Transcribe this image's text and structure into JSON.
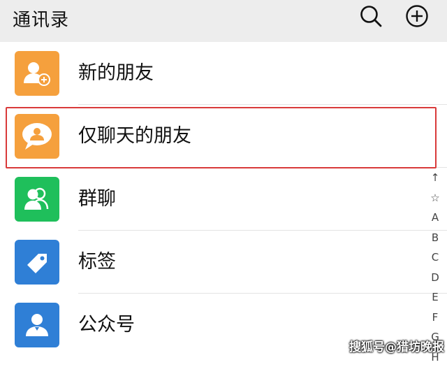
{
  "header": {
    "title": "通讯录",
    "search_icon": "search-icon",
    "add_icon": "plus-circle-icon"
  },
  "list": {
    "items": [
      {
        "label": "新的朋友",
        "icon": "add-friend-icon",
        "color": "#f5a03d"
      },
      {
        "label": "仅聊天的朋友",
        "icon": "chat-bubble-person-icon",
        "color": "#f5a03d"
      },
      {
        "label": "群聊",
        "icon": "group-icon",
        "color": "#1fbf5b"
      },
      {
        "label": "标签",
        "icon": "tag-icon",
        "color": "#2f7fd6"
      },
      {
        "label": "公众号",
        "icon": "official-account-icon",
        "color": "#2f7fd6"
      }
    ]
  },
  "index_bar": [
    "↑",
    "☆",
    "A",
    "B",
    "C",
    "D",
    "E",
    "F",
    "G",
    "H"
  ],
  "highlight_color": "#d93a3a",
  "watermark": "搜狐号@猎坊晚报"
}
